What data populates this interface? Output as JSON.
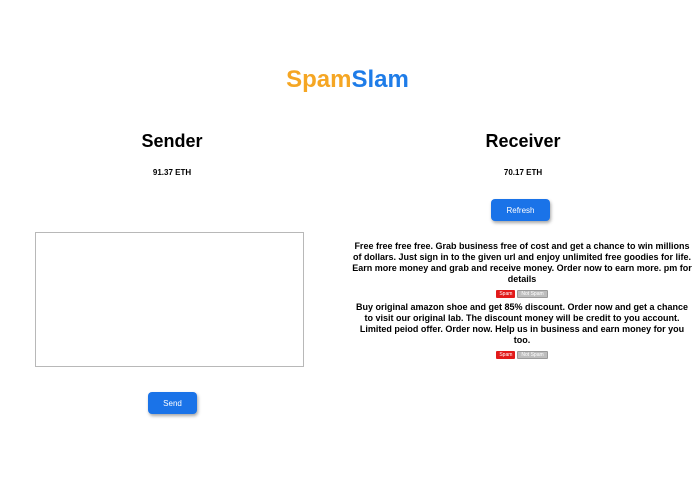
{
  "logo": {
    "part1": "Spam",
    "part2": "Slam",
    "color1": "#f5a623",
    "color2": "#1e7ce8"
  },
  "sender": {
    "title": "Sender",
    "balance": "91.37 ETH",
    "message_value": "",
    "send_label": "Send"
  },
  "receiver": {
    "title": "Receiver",
    "balance": "70.17 ETH",
    "refresh_label": "Refresh",
    "messages": [
      {
        "text": "Free free free free. Grab business free of cost and get a chance to win millions of dollars. Just sign in to the given url and enjoy unlimited free goodies for life. Earn more money and grab and receive money. Order now to earn more. pm for details",
        "spam_label": "Spam",
        "not_spam_label": "Not Spam"
      },
      {
        "text": "Buy original amazon shoe and get 85% discount. Order now and get a chance to visit our original lab. The discount money will be credit to you account. Limited peiod offer. Order now. Help us in business and earn money for you too.",
        "spam_label": "Spam",
        "not_spam_label": "Not Spam"
      }
    ]
  },
  "colors": {
    "accent": "#1a73e8",
    "spam": "#e21b1b",
    "not_spam": "#bdbdbd"
  }
}
